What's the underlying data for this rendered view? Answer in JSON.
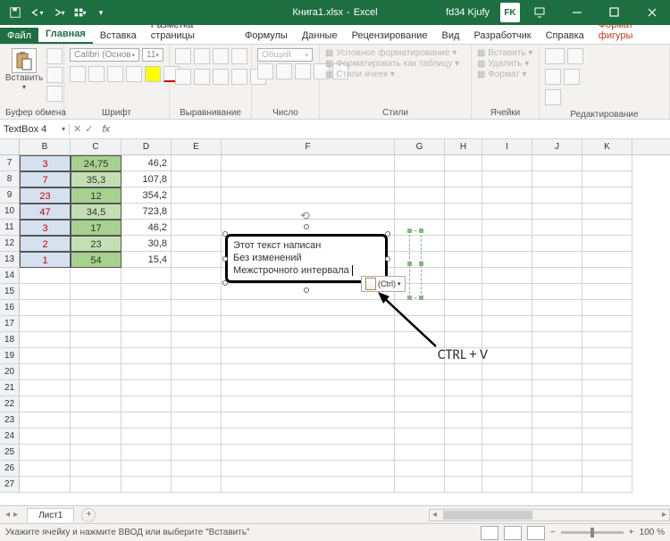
{
  "titlebar": {
    "filename": "Книга1.xlsx",
    "app": "Excel",
    "user": "fd34 Kjufy",
    "user_initials": "FK"
  },
  "menu": {
    "file": "Файл",
    "tabs": [
      "Главная",
      "Вставка",
      "Разметка страницы",
      "Формулы",
      "Данные",
      "Рецензирование",
      "Вид",
      "Разработчик",
      "Справка"
    ],
    "context_tab": "Формат фигуры",
    "active_index": 0
  },
  "ribbon": {
    "clipboard": {
      "paste": "Вставить",
      "label": "Буфер обмена"
    },
    "font": {
      "name": "Calibri (Основ",
      "size": "11",
      "label": "Шрифт"
    },
    "alignment": {
      "label": "Выравнивание"
    },
    "number": {
      "format": "Общий",
      "label": "Число"
    },
    "styles": {
      "cond": "Условное форматирование",
      "table": "Форматировать как таблицу",
      "cell": "Стили ячеек",
      "label": "Стили"
    },
    "cells": {
      "insert": "Вставить",
      "delete": "Удалить",
      "format": "Формат",
      "label": "Ячейки"
    },
    "editing": {
      "label": "Редактирование"
    }
  },
  "namebox": "TextBox 4",
  "fx_label": "fx",
  "grid": {
    "columns": [
      "B",
      "C",
      "D",
      "E",
      "F",
      "G",
      "H",
      "I",
      "J",
      "K"
    ],
    "rows": [
      7,
      8,
      9,
      10,
      11,
      12,
      13,
      14,
      15,
      16,
      17,
      18,
      19,
      20,
      21,
      22,
      23,
      24,
      25,
      26,
      27
    ],
    "data": [
      {
        "r": 7,
        "B": "3",
        "C": "24,75",
        "D": "46,2",
        "c_bg": "g1"
      },
      {
        "r": 8,
        "B": "7",
        "C": "35,3",
        "D": "107,8",
        "c_bg": "g2"
      },
      {
        "r": 9,
        "B": "23",
        "C": "12",
        "D": "354,2",
        "c_bg": "g1"
      },
      {
        "r": 10,
        "B": "47",
        "C": "34,5",
        "D": "723,8",
        "c_bg": "g2"
      },
      {
        "r": 11,
        "B": "3",
        "C": "17",
        "D": "46,2",
        "c_bg": "g1"
      },
      {
        "r": 12,
        "B": "2",
        "C": "23",
        "D": "30,8",
        "c_bg": "g2"
      },
      {
        "r": 13,
        "B": "1",
        "C": "54",
        "D": "15,4",
        "c_bg": "g1"
      }
    ]
  },
  "textbox": {
    "line1": "Этот текст написан",
    "line2": "Без изменений",
    "line3": "Межстрочного интервала"
  },
  "paste_options": "(Ctrl)",
  "annotation": "CTRL  +  V",
  "sheet": {
    "name": "Лист1"
  },
  "status": {
    "hint": "Укажите ячейку и нажмите ВВОД или выберите \"Вставить\"",
    "zoom": "100 %"
  }
}
